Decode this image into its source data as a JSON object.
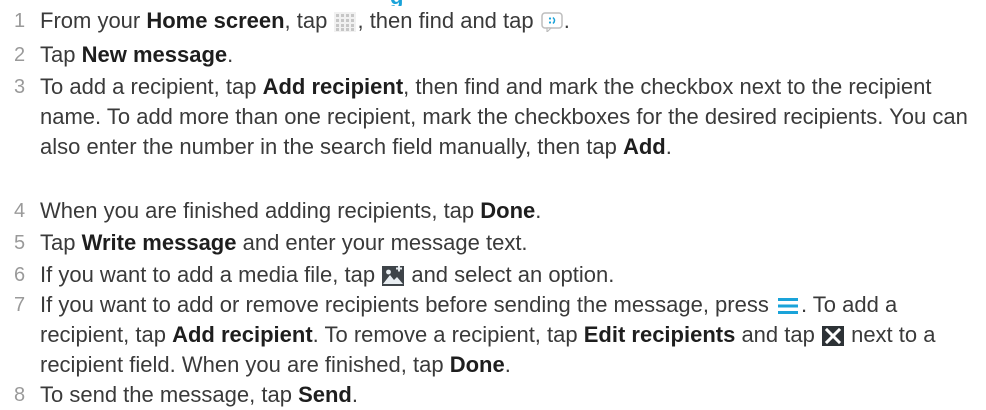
{
  "header": {
    "partial_title": "g"
  },
  "steps": [
    {
      "number": "1",
      "t1": "From your ",
      "b1": "Home screen",
      "t2": ", tap ",
      "t3": ", then find and tap ",
      "t4": "."
    },
    {
      "number": "2",
      "t1": "Tap ",
      "b1": "New message",
      "t2": "."
    },
    {
      "number": "3",
      "t1": "To add a recipient, tap ",
      "b1": "Add recipient",
      "t2": ", then find and mark the checkbox next to the recipient name. To add more than one recipient, mark the checkboxes for the desired recipients. You can also enter the number in the search field manually, then tap ",
      "b2": "Add",
      "t3": "."
    },
    {
      "number": "4",
      "t1": "When you are finished adding recipients, tap ",
      "b1": "Done",
      "t2": "."
    },
    {
      "number": "5",
      "t1": "Tap ",
      "b1": "Write message",
      "t2": " and enter your message text."
    },
    {
      "number": "6",
      "t1": "If you want to add a media file, tap ",
      "t2": " and select an option."
    },
    {
      "number": "7",
      "t1": "If you want to add or remove recipients before sending the message, press ",
      "t2": ". To add a recipient, tap ",
      "b1": "Add recipient",
      "t3": ". To remove a recipient, tap ",
      "b2": "Edit recipients",
      "t4": " and tap ",
      "t5": " next to a recipient field. When you are finished, tap ",
      "b3": "Done",
      "t6": "."
    },
    {
      "number": "8",
      "t1": "To send the message, tap ",
      "b1": "Send",
      "t2": "."
    }
  ],
  "icons": {
    "apps": "apps-grid-icon",
    "messaging": "messaging-icon",
    "media": "add-media-icon",
    "menu": "menu-icon",
    "remove": "remove-x-icon"
  },
  "colors": {
    "accent": "#1aa3d9",
    "text": "#3a3a3a",
    "bold": "#1e1e1e",
    "number": "#9a9a9a"
  }
}
